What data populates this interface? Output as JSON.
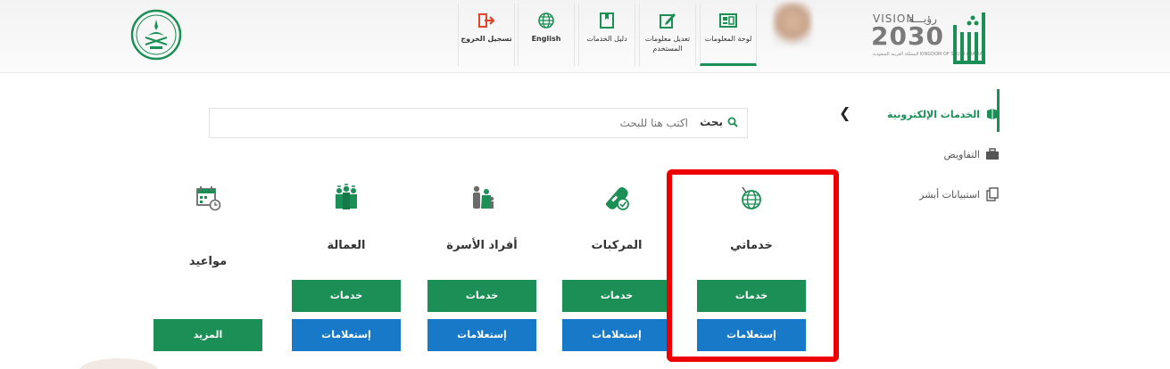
{
  "header": {
    "vision_title": "VISION",
    "vision_arabic": "رؤيـــة",
    "vision_year": "2030",
    "vision_sub": "المملكة العربية السعودية KINGDOM OF SAUDI ARABIA",
    "nav": [
      {
        "label": "لوحة المعلومات",
        "icon": "dashboard-icon"
      },
      {
        "label": "تعديل معلومات المستخدم",
        "icon": "edit-icon"
      },
      {
        "label": "دليل الخدمات",
        "icon": "book-icon"
      },
      {
        "label": "English",
        "icon": "globe-icon"
      },
      {
        "label": "تسجيل الخروج",
        "icon": "logout-icon"
      }
    ]
  },
  "sidebar": {
    "items": [
      {
        "label": "الخدمات الإلكترونية",
        "icon": "eservices-icon"
      },
      {
        "label": "التفاويض",
        "icon": "briefcase-icon"
      },
      {
        "label": "استبيانات أبشر",
        "icon": "survey-icon"
      }
    ]
  },
  "search": {
    "button_label": "بحث",
    "placeholder": "اكتب هنا للبحث"
  },
  "cards": [
    {
      "title": "خدماتي",
      "icon": "globe-icon",
      "services_label": "خدمات",
      "inquiries_label": "إستعلامات"
    },
    {
      "title": "المركبات",
      "icon": "vehicle-icon",
      "services_label": "خدمات",
      "inquiries_label": "إستعلامات"
    },
    {
      "title": "أفراد الأسرة",
      "icon": "family-icon",
      "services_label": "خدمات",
      "inquiries_label": "إستعلامات"
    },
    {
      "title": "العمالة",
      "icon": "workers-icon",
      "services_label": "خدمات",
      "inquiries_label": "إستعلامات"
    },
    {
      "title": "مواعيد",
      "icon": "calendar-icon",
      "more_label": "المزيد"
    }
  ],
  "colors": {
    "green": "#1b8f55",
    "blue": "#1979c9",
    "highlight": "#ee0000"
  }
}
